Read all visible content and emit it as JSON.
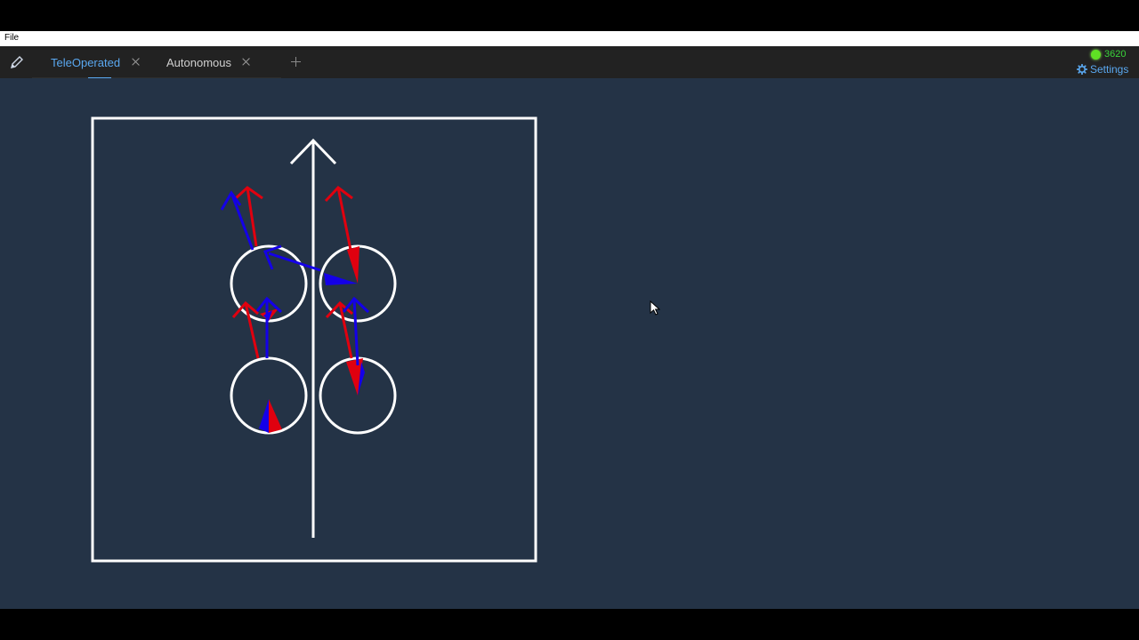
{
  "menubar": {
    "file_label": "File"
  },
  "tabs": [
    {
      "label": "TeleOperated",
      "active": true
    },
    {
      "label": "Autonomous",
      "active": false
    }
  ],
  "status": {
    "team_number": "3620",
    "connected_color": "#5fe024"
  },
  "settings": {
    "label": "Settings"
  },
  "icons": {
    "edit": "pencil-icon",
    "close": "close-icon",
    "add": "plus-icon",
    "settings": "gear-icon"
  },
  "swerve": {
    "colors": {
      "frame": "#ffffff",
      "commanded": "#e0000f",
      "measured": "#1400e8"
    },
    "modules": [
      {
        "position": "front-left"
      },
      {
        "position": "front-right"
      },
      {
        "position": "back-left"
      },
      {
        "position": "back-right"
      }
    ]
  },
  "theme": {
    "background": "#243346",
    "tabbar": "#222222",
    "accent": "#5aa8f0"
  }
}
